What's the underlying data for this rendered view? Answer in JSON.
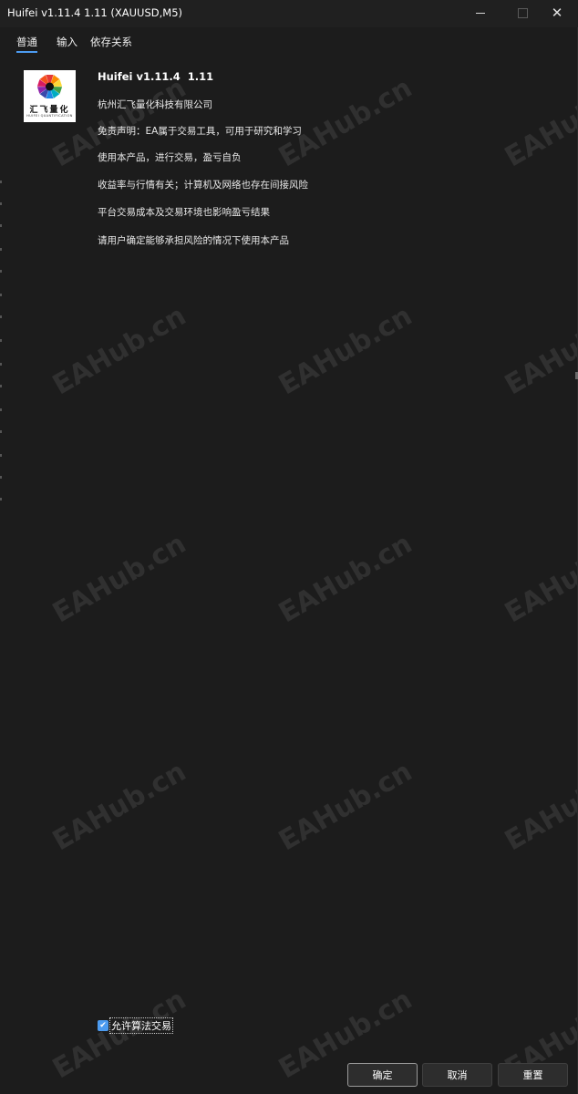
{
  "window": {
    "title": "Huifei v1.11.4  1.11 (XAUUSD,M5)",
    "controls": {
      "minimize": "minimize-icon",
      "maximize": "maximize-icon",
      "close": "close-icon",
      "close_glyph": "✕"
    }
  },
  "tabs": [
    {
      "label": "普通",
      "active": true
    },
    {
      "label": "输入",
      "active": false
    },
    {
      "label": "依存关系",
      "active": false
    }
  ],
  "logo": {
    "name_cn": "汇飞量化",
    "name_en": "HUIFEI QUANTIFICATION"
  },
  "info": {
    "title": "Huifei v1.11.4  1.11",
    "lines": [
      "杭州汇飞量化科技有限公司",
      "免责声明：EA属于交易工具，可用于研究和学习",
      "使用本产品，进行交易，盈亏自负",
      "收益率与行情有关；计算机及网络也存在间接风险",
      "平台交易成本及交易环境也影响盈亏结果",
      "请用户确定能够承担风险的情况下使用本产品"
    ]
  },
  "watermark": "EAHub.cn",
  "checkbox": {
    "label": "允许算法交易",
    "checked": true,
    "check_glyph": "✔"
  },
  "buttons": {
    "ok": "确定",
    "cancel": "取消",
    "reset": "重置"
  },
  "colors": {
    "background": "#1c1c1c",
    "titlebar": "#202020",
    "accent": "#4c9bf0",
    "text": "#ffffff"
  }
}
